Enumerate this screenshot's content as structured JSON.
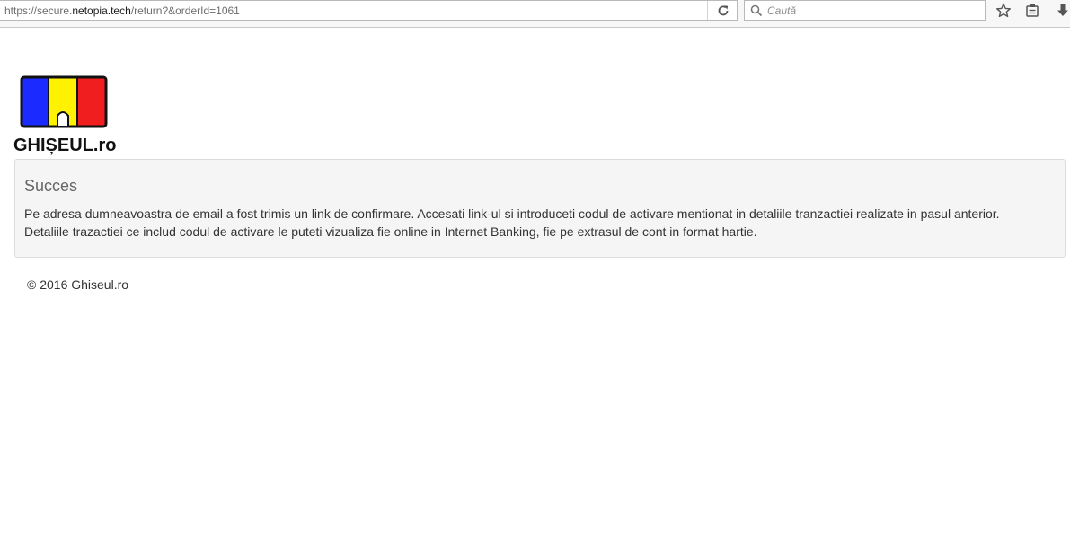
{
  "browser": {
    "url_prefix": "https://secure.",
    "url_host": "netopia.tech",
    "url_suffix": "/return?&orderId=1061",
    "search_placeholder": "Caută",
    "icons": [
      "reload-icon",
      "search-icon",
      "star-icon",
      "reading-list-icon",
      "download-icon"
    ]
  },
  "logo": {
    "text": "GHIȘEUL.ro",
    "colors": {
      "blue": "#1b2bff",
      "yellow": "#fff200",
      "red": "#f01e1e"
    }
  },
  "panel": {
    "title": "Succes",
    "line1": "Pe adresa dumneavoastra de email a fost trimis un link de confirmare. Accesati link-ul si introduceti codul de activare mentionat in detaliile tranzactiei realizate in pasul anterior.",
    "line2": "Detaliile trazactiei ce includ codul de activare le puteti vizualiza fie online in Internet Banking, fie pe extrasul de cont in format hartie."
  },
  "footer": {
    "text": "© 2016 Ghiseul.ro"
  }
}
